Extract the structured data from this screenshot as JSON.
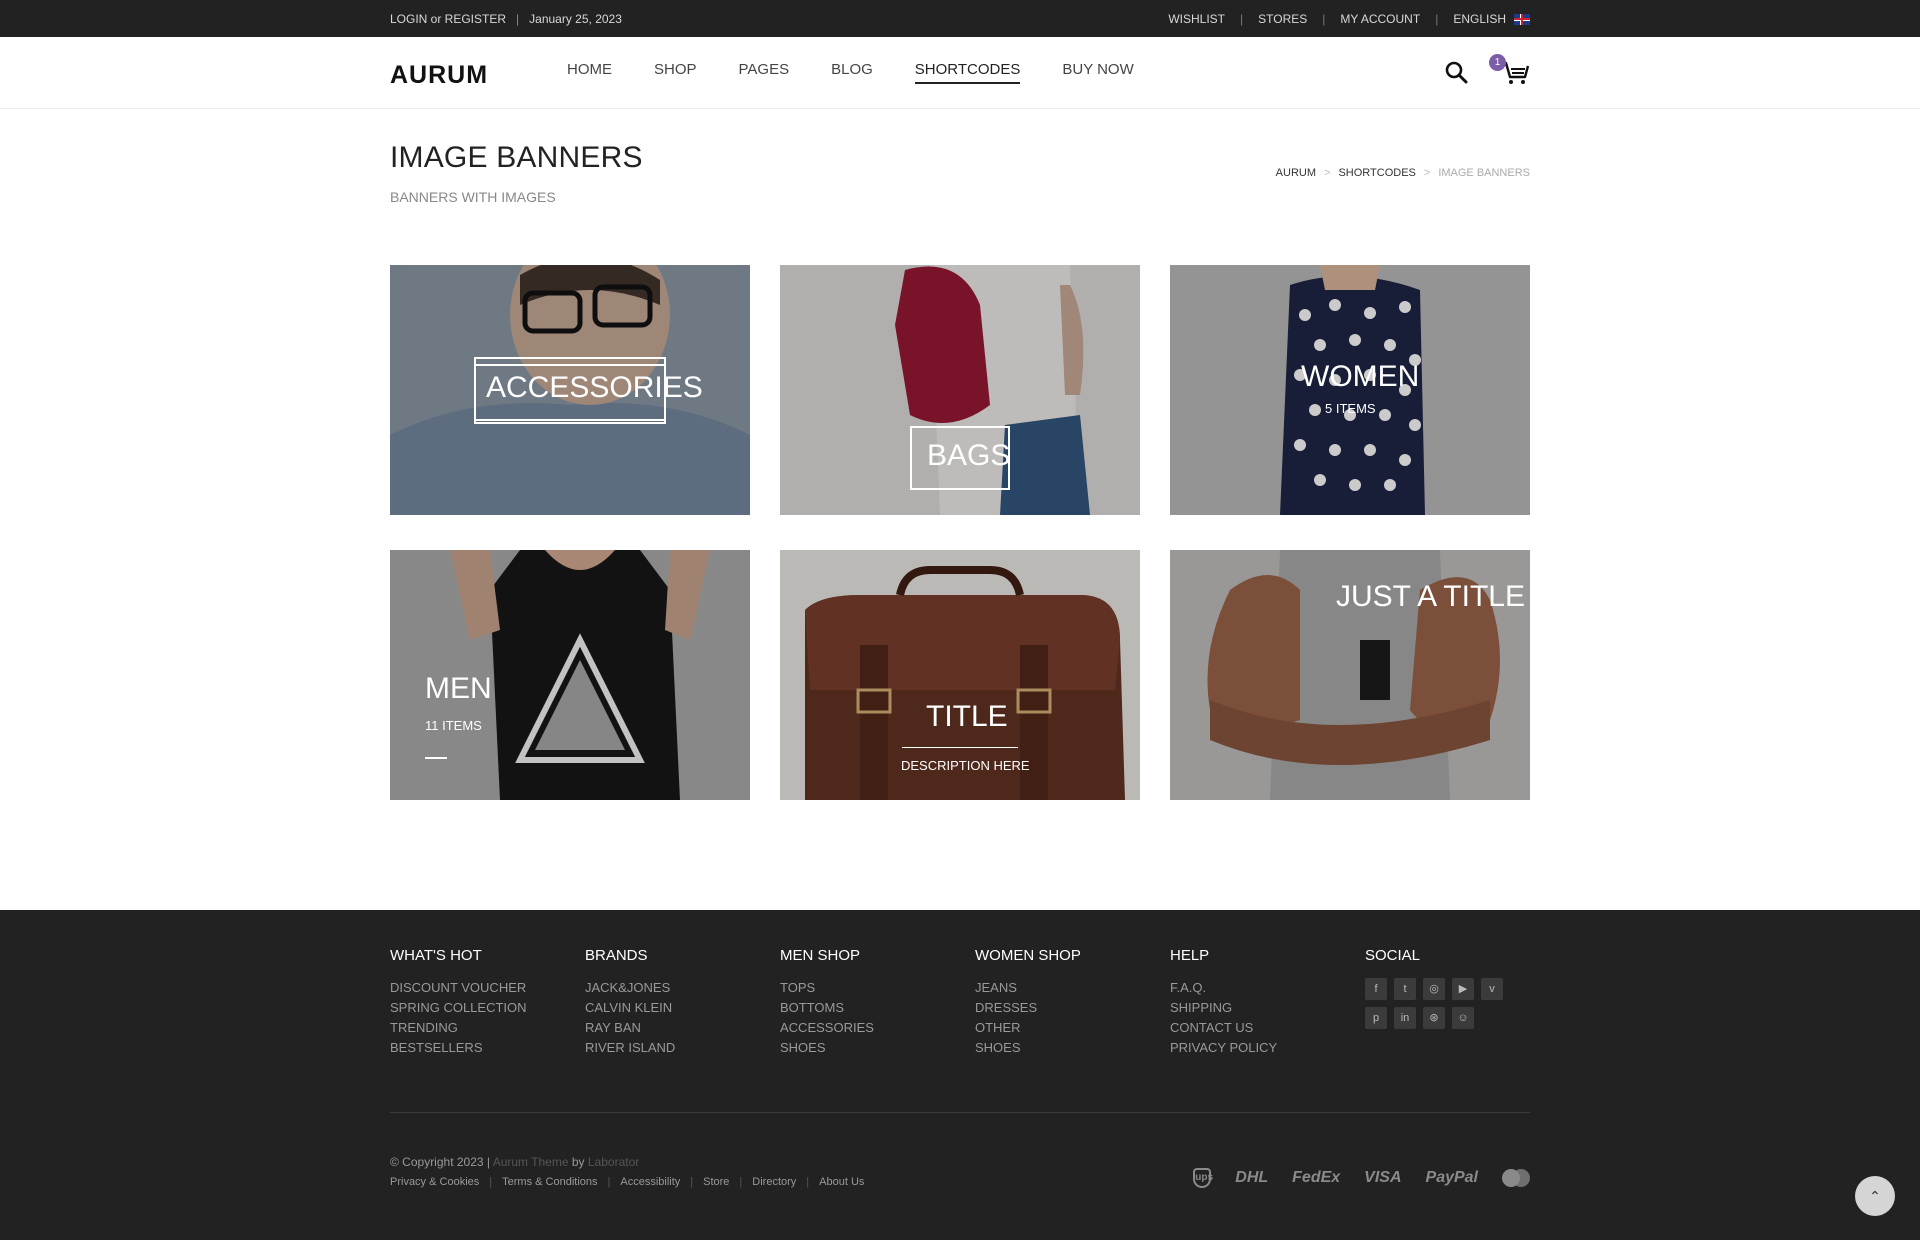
{
  "topbar": {
    "login": "LOGIN or REGISTER",
    "separator": "|",
    "date": "January 25, 2023",
    "links": [
      "WISHLIST",
      "STORES",
      "MY ACCOUNT",
      "ENGLISH"
    ]
  },
  "header": {
    "logo": "AURUM",
    "nav": [
      "HOME",
      "SHOP",
      "PAGES",
      "BLOG",
      "SHORTCODES",
      "BUY NOW"
    ],
    "active_nav": "SHORTCODES",
    "cart_count": "1",
    "badge_color": "#7b5ea7"
  },
  "page": {
    "title": "IMAGE BANNERS",
    "subtitle": "BANNERS WITH IMAGES",
    "breadcrumb": [
      "AURUM",
      "SHORTCODES",
      "IMAGE BANNERS"
    ],
    "breadcrumb_sep": ">"
  },
  "banners": [
    {
      "title": "ACCESSORIES"
    },
    {
      "title": "BAGS"
    },
    {
      "title": "WOMEN",
      "sub": "5 ITEMS"
    },
    {
      "title": "MEN",
      "sub": "11 ITEMS"
    },
    {
      "title": "TITLE",
      "sub": "DESCRIPTION HERE"
    },
    {
      "title": "JUST A TITLE"
    }
  ],
  "footer": {
    "columns": [
      {
        "heading": "WHAT'S HOT",
        "links": [
          "DISCOUNT VOUCHER",
          "SPRING COLLECTION",
          "TRENDING",
          "BESTSELLERS"
        ]
      },
      {
        "heading": "BRANDS",
        "links": [
          "JACK&JONES",
          "CALVIN KLEIN",
          "RAY BAN",
          "RIVER ISLAND"
        ]
      },
      {
        "heading": "MEN SHOP",
        "links": [
          "TOPS",
          "BOTTOMS",
          "ACCESSORIES",
          "SHOES"
        ]
      },
      {
        "heading": "WOMEN SHOP",
        "links": [
          "JEANS",
          "DRESSES",
          "OTHER",
          "SHOES"
        ]
      },
      {
        "heading": "HELP",
        "links": [
          "F.A.Q.",
          "SHIPPING",
          "CONTACT US",
          "PRIVACY POLICY"
        ]
      }
    ],
    "social_heading": "SOCIAL",
    "social_icons": [
      "facebook-icon",
      "twitter-icon",
      "instagram-icon",
      "youtube-icon",
      "vimeo-icon",
      "pinterest-icon",
      "linkedin-icon",
      "dribbble-icon",
      "snapchat-icon"
    ],
    "copyright_prefix": "© Copyright 2023 |",
    "theme": "Aurum Theme",
    "by": "by",
    "author": "Laborator",
    "bottom_links": [
      "Privacy & Cookies",
      "Terms & Conditions",
      "Accessibility",
      "Store",
      "Directory",
      "About Us"
    ],
    "payments": [
      "ups",
      "DHL",
      "FedEx",
      "VISA",
      "PayPal",
      "mastercard"
    ]
  }
}
